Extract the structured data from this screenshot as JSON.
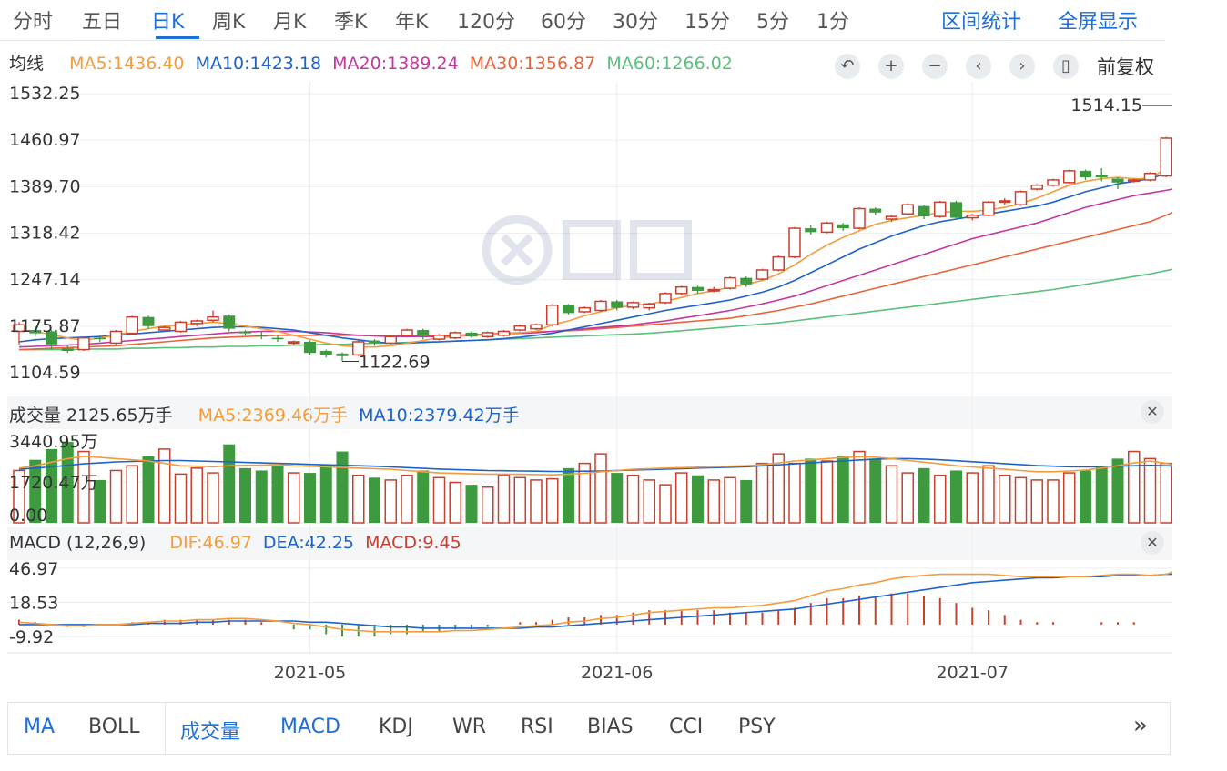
{
  "periods": [
    "分时",
    "五日",
    "日K",
    "周K",
    "月K",
    "季K",
    "年K",
    "120分",
    "60分",
    "30分",
    "15分",
    "5分",
    "1分"
  ],
  "active_period": "日K",
  "right_links": {
    "range_stats": "区间统计",
    "fullscreen": "全屏显示"
  },
  "main": {
    "label": "均线",
    "ma5": "MA5:1436.40",
    "ma10": "MA10:1423.18",
    "ma20": "MA20:1389.24",
    "ma30": "MA30:1356.87",
    "ma60": "MA60:1266.02",
    "adjust": "前复权",
    "y_ticks": [
      "1532.25",
      "1460.97",
      "1389.70",
      "1318.42",
      "1247.14",
      "1175.87",
      "1104.59"
    ],
    "max_label": "1514.15",
    "min_label": "1122.69"
  },
  "volume": {
    "label": "成交量 2125.65万手",
    "ma5": "MA5:2369.46万手",
    "ma10": "MA10:2379.42万手",
    "y_ticks": [
      "3440.95万",
      "1720.47万",
      "0.00"
    ]
  },
  "macd": {
    "label": "MACD (12,26,9)",
    "dif": "DIF:46.97",
    "dea": "DEA:42.25",
    "macd": "MACD:9.45",
    "y_ticks": [
      "46.97",
      "18.53",
      "-9.92"
    ]
  },
  "x_labels": [
    "2021-05",
    "2021-06",
    "2021-07"
  ],
  "indicators": [
    "MA",
    "BOLL",
    "成交量",
    "MACD",
    "KDJ",
    "WR",
    "RSI",
    "BIAS",
    "CCI",
    "PSY"
  ],
  "active_indicators": [
    "MA",
    "成交量",
    "MACD"
  ],
  "colors": {
    "up": "#c8402f",
    "down": "#3d9a3f",
    "ma5": "#f39c3d",
    "ma10": "#1e63c8",
    "ma20": "#c2389e",
    "ma30": "#e8643a",
    "ma60": "#5bc07a",
    "accent": "#1e6fd9"
  },
  "chart_data": [
    {
      "type": "candlestick",
      "title": "",
      "ylim": [
        1104.59,
        1532.25
      ],
      "x_ticks": {
        "2021-05": 18,
        "2021-06": 37,
        "2021-07": 59
      },
      "candles": [
        [
          1168,
          1178,
          1148,
          1182
        ],
        [
          1170,
          1165,
          1160,
          1176
        ],
        [
          1168,
          1148,
          1140,
          1170
        ],
        [
          1142,
          1138,
          1135,
          1146
        ],
        [
          1140,
          1158,
          1138,
          1160
        ],
        [
          1158,
          1156,
          1152,
          1162
        ],
        [
          1150,
          1168,
          1148,
          1170
        ],
        [
          1165,
          1190,
          1163,
          1192
        ],
        [
          1190,
          1176,
          1172,
          1192
        ],
        [
          1170,
          1174,
          1168,
          1176
        ],
        [
          1168,
          1182,
          1166,
          1184
        ],
        [
          1180,
          1184,
          1176,
          1186
        ],
        [
          1185,
          1190,
          1182,
          1200
        ],
        [
          1192,
          1172,
          1168,
          1194
        ],
        [
          1168,
          1165,
          1162,
          1170
        ],
        [
          1162,
          1160,
          1156,
          1168
        ],
        [
          1158,
          1156,
          1152,
          1162
        ],
        [
          1150,
          1152,
          1146,
          1154
        ],
        [
          1152,
          1135,
          1132,
          1154
        ],
        [
          1138,
          1132,
          1128,
          1140
        ],
        [
          1134,
          1130,
          1122,
          1136
        ],
        [
          1132,
          1152,
          1130,
          1154
        ],
        [
          1154,
          1150,
          1146,
          1156
        ],
        [
          1150,
          1160,
          1148,
          1162
        ],
        [
          1162,
          1170,
          1160,
          1172
        ],
        [
          1170,
          1162,
          1156,
          1172
        ],
        [
          1156,
          1162,
          1154,
          1164
        ],
        [
          1158,
          1166,
          1156,
          1168
        ],
        [
          1166,
          1160,
          1158,
          1168
        ],
        [
          1160,
          1166,
          1158,
          1168
        ],
        [
          1162,
          1168,
          1160,
          1170
        ],
        [
          1170,
          1176,
          1168,
          1178
        ],
        [
          1172,
          1178,
          1170,
          1180
        ],
        [
          1178,
          1208,
          1176,
          1210
        ],
        [
          1208,
          1196,
          1194,
          1210
        ],
        [
          1198,
          1204,
          1196,
          1206
        ],
        [
          1200,
          1214,
          1198,
          1216
        ],
        [
          1214,
          1204,
          1200,
          1216
        ],
        [
          1205,
          1212,
          1202,
          1214
        ],
        [
          1204,
          1210,
          1200,
          1212
        ],
        [
          1212,
          1226,
          1210,
          1228
        ],
        [
          1226,
          1236,
          1224,
          1238
        ],
        [
          1236,
          1230,
          1226,
          1238
        ],
        [
          1230,
          1232,
          1228,
          1236
        ],
        [
          1234,
          1250,
          1232,
          1252
        ],
        [
          1250,
          1240,
          1236,
          1252
        ],
        [
          1248,
          1262,
          1246,
          1264
        ],
        [
          1262,
          1282,
          1260,
          1284
        ],
        [
          1282,
          1326,
          1280,
          1328
        ],
        [
          1326,
          1320,
          1316,
          1330
        ],
        [
          1320,
          1334,
          1318,
          1336
        ],
        [
          1332,
          1326,
          1322,
          1334
        ],
        [
          1326,
          1356,
          1324,
          1358
        ],
        [
          1356,
          1350,
          1346,
          1358
        ],
        [
          1340,
          1344,
          1336,
          1346
        ],
        [
          1348,
          1362,
          1346,
          1364
        ],
        [
          1360,
          1344,
          1340,
          1362
        ],
        [
          1344,
          1366,
          1342,
          1368
        ],
        [
          1366,
          1342,
          1340,
          1368
        ],
        [
          1342,
          1346,
          1338,
          1348
        ],
        [
          1346,
          1366,
          1344,
          1368
        ],
        [
          1366,
          1368,
          1362,
          1372
        ],
        [
          1362,
          1382,
          1360,
          1384
        ],
        [
          1386,
          1392,
          1384,
          1394
        ],
        [
          1392,
          1400,
          1390,
          1402
        ],
        [
          1396,
          1414,
          1394,
          1416
        ],
        [
          1414,
          1404,
          1400,
          1416
        ],
        [
          1408,
          1404,
          1398,
          1418
        ],
        [
          1402,
          1396,
          1386,
          1404
        ],
        [
          1398,
          1400,
          1396,
          1402
        ],
        [
          1400,
          1410,
          1398,
          1412
        ],
        [
          1406,
          1464,
          1404,
          1466
        ],
        [
          1478,
          1512,
          1476,
          1514
        ]
      ],
      "ma5": [
        1170,
        1168,
        1163,
        1158,
        1154,
        1158,
        1162,
        1168,
        1172,
        1176,
        1178,
        1180,
        1182,
        1180,
        1176,
        1172,
        1168,
        1162,
        1156,
        1150,
        1146,
        1144,
        1144,
        1146,
        1150,
        1154,
        1158,
        1160,
        1162,
        1163,
        1164,
        1166,
        1168,
        1178,
        1184,
        1192,
        1198,
        1204,
        1208,
        1210,
        1214,
        1220,
        1226,
        1230,
        1236,
        1240,
        1246,
        1256,
        1270,
        1286,
        1300,
        1312,
        1322,
        1332,
        1338,
        1342,
        1346,
        1350,
        1352,
        1352,
        1354,
        1358,
        1364,
        1372,
        1382,
        1392,
        1398,
        1402,
        1404,
        1402,
        1402,
        1418,
        1436
      ],
      "ma10": [
        1152,
        1155,
        1157,
        1158,
        1159,
        1160,
        1162,
        1164,
        1166,
        1168,
        1170,
        1172,
        1174,
        1175,
        1175,
        1174,
        1172,
        1170,
        1166,
        1162,
        1158,
        1155,
        1152,
        1150,
        1150,
        1151,
        1152,
        1153,
        1154,
        1155,
        1157,
        1159,
        1162,
        1165,
        1170,
        1175,
        1180,
        1185,
        1190,
        1195,
        1200,
        1204,
        1208,
        1212,
        1216,
        1222,
        1228,
        1236,
        1246,
        1258,
        1270,
        1282,
        1294,
        1304,
        1314,
        1322,
        1330,
        1336,
        1340,
        1344,
        1348,
        1352,
        1356,
        1360,
        1366,
        1374,
        1382,
        1388,
        1394,
        1398,
        1402,
        1410,
        1423
      ],
      "ma20": [
        1144,
        1145,
        1146,
        1147,
        1148,
        1150,
        1152,
        1154,
        1156,
        1158,
        1160,
        1162,
        1164,
        1166,
        1167,
        1168,
        1168,
        1168,
        1167,
        1166,
        1164,
        1162,
        1161,
        1160,
        1160,
        1160,
        1160,
        1161,
        1162,
        1163,
        1164,
        1165,
        1166,
        1168,
        1170,
        1172,
        1174,
        1176,
        1178,
        1181,
        1184,
        1188,
        1192,
        1196,
        1200,
        1205,
        1210,
        1216,
        1222,
        1230,
        1238,
        1246,
        1254,
        1262,
        1270,
        1278,
        1286,
        1294,
        1302,
        1310,
        1316,
        1322,
        1328,
        1334,
        1342,
        1350,
        1358,
        1364,
        1370,
        1376,
        1380,
        1384,
        1389
      ],
      "ma30": [
        1140,
        1141,
        1142,
        1143,
        1144,
        1145,
        1146,
        1148,
        1150,
        1152,
        1154,
        1156,
        1158,
        1159,
        1160,
        1161,
        1162,
        1162,
        1162,
        1162,
        1162,
        1162,
        1161,
        1161,
        1161,
        1161,
        1162,
        1162,
        1163,
        1164,
        1165,
        1166,
        1167,
        1168,
        1169,
        1170,
        1172,
        1174,
        1176,
        1178,
        1180,
        1182,
        1184,
        1186,
        1188,
        1192,
        1196,
        1200,
        1205,
        1210,
        1216,
        1222,
        1228,
        1234,
        1240,
        1246,
        1252,
        1258,
        1264,
        1270,
        1276,
        1282,
        1288,
        1294,
        1300,
        1306,
        1312,
        1318,
        1324,
        1330,
        1336,
        1346,
        1357
      ],
      "ma60": [
        1140,
        1140,
        1140,
        1140,
        1141,
        1141,
        1141,
        1142,
        1142,
        1143,
        1143,
        1144,
        1144,
        1145,
        1145,
        1146,
        1146,
        1147,
        1147,
        1148,
        1148,
        1149,
        1150,
        1150,
        1151,
        1152,
        1152,
        1153,
        1154,
        1155,
        1156,
        1157,
        1158,
        1159,
        1160,
        1161,
        1162,
        1163,
        1164,
        1165,
        1167,
        1169,
        1171,
        1173,
        1175,
        1177,
        1179,
        1181,
        1184,
        1187,
        1190,
        1193,
        1196,
        1199,
        1202,
        1205,
        1208,
        1211,
        1214,
        1217,
        1220,
        1223,
        1226,
        1229,
        1232,
        1236,
        1240,
        1244,
        1248,
        1252,
        1256,
        1261,
        1266
      ]
    },
    {
      "type": "bar",
      "title": "成交量",
      "ylim": [
        0,
        3440.95
      ],
      "values": [
        2200,
        2650,
        3100,
        3400,
        3000,
        1800,
        2200,
        2400,
        2800,
        3100,
        2050,
        2300,
        2100,
        3300,
        2300,
        2200,
        2400,
        2100,
        2100,
        2450,
        3000,
        2000,
        1900,
        1800,
        2000,
        2200,
        1900,
        1700,
        1600,
        1500,
        2000,
        1900,
        1800,
        1850,
        2300,
        2500,
        2900,
        2100,
        2000,
        1800,
        1600,
        2100,
        2000,
        1800,
        1900,
        1800,
        2500,
        2900,
        2500,
        2700,
        2600,
        2800,
        3000,
        2700,
        2400,
        2100,
        2300,
        2000,
        2200,
        2100,
        2400,
        2000,
        1900,
        1800,
        1800,
        2100,
        2200,
        2400,
        2700,
        3000,
        2700,
        2500,
        2125.65
      ],
      "ma5": [
        2300,
        2400,
        2550,
        2700,
        2800,
        2750,
        2700,
        2650,
        2600,
        2500,
        2400,
        2380,
        2350,
        2400,
        2420,
        2420,
        2450,
        2400,
        2380,
        2350,
        2330,
        2300,
        2280,
        2250,
        2200,
        2150,
        2100,
        2080,
        2060,
        2050,
        2050,
        2040,
        2030,
        2020,
        2040,
        2080,
        2150,
        2200,
        2250,
        2280,
        2300,
        2320,
        2340,
        2360,
        2380,
        2400,
        2450,
        2520,
        2600,
        2650,
        2700,
        2750,
        2780,
        2760,
        2700,
        2620,
        2550,
        2480,
        2400,
        2350,
        2300,
        2250,
        2200,
        2150,
        2150,
        2180,
        2220,
        2300,
        2400,
        2520,
        2600,
        2500,
        2369.46
      ],
      "ma10": [
        2250,
        2300,
        2350,
        2420,
        2480,
        2520,
        2560,
        2580,
        2600,
        2620,
        2620,
        2600,
        2580,
        2560,
        2540,
        2520,
        2500,
        2480,
        2460,
        2440,
        2420,
        2400,
        2380,
        2350,
        2320,
        2290,
        2260,
        2240,
        2220,
        2200,
        2190,
        2180,
        2170,
        2160,
        2160,
        2170,
        2180,
        2200,
        2220,
        2240,
        2260,
        2280,
        2300,
        2320,
        2340,
        2360,
        2400,
        2440,
        2480,
        2520,
        2560,
        2600,
        2640,
        2680,
        2700,
        2700,
        2680,
        2650,
        2610,
        2570,
        2530,
        2490,
        2450,
        2410,
        2380,
        2360,
        2350,
        2360,
        2380,
        2400,
        2420,
        2400,
        2379.42
      ]
    },
    {
      "type": "bar",
      "title": "MACD (12,26,9)",
      "ylim": [
        -9.92,
        46.97
      ],
      "dif": [
        2,
        1,
        0,
        -1,
        -1,
        0,
        0,
        1,
        2,
        3,
        3,
        4,
        4,
        5,
        5,
        4,
        3,
        1,
        0,
        -2,
        -4,
        -5,
        -6,
        -6,
        -6,
        -6,
        -6,
        -5,
        -5,
        -4,
        -3,
        -2,
        -1,
        0,
        2,
        3,
        5,
        6,
        8,
        10,
        11,
        12,
        13,
        14,
        14,
        15,
        16,
        18,
        20,
        24,
        28,
        30,
        33,
        35,
        38,
        40,
        41,
        42,
        42,
        42,
        42,
        41,
        40,
        40,
        40,
        40,
        40,
        41,
        42,
        42,
        41,
        42,
        47
      ],
      "dea": [
        0,
        0,
        0,
        0,
        0,
        0,
        0,
        0,
        1,
        1,
        1,
        2,
        2,
        3,
        3,
        3,
        3,
        3,
        2,
        2,
        1,
        0,
        -1,
        -2,
        -2,
        -3,
        -3,
        -3,
        -3,
        -3,
        -3,
        -3,
        -2,
        -2,
        -1,
        0,
        1,
        2,
        3,
        4,
        5,
        6,
        7,
        8,
        9,
        10,
        11,
        12,
        13,
        15,
        17,
        19,
        21,
        23,
        25,
        27,
        29,
        31,
        33,
        35,
        36,
        37,
        38,
        39,
        39,
        40,
        40,
        40,
        41,
        41,
        41,
        42,
        42.25
      ],
      "macd": [
        4,
        2,
        0,
        -2,
        -2,
        0,
        0,
        2,
        2,
        4,
        4,
        4,
        4,
        4,
        4,
        2,
        0,
        -4,
        -4,
        -8,
        -10,
        -10,
        -10,
        -8,
        -8,
        -6,
        -6,
        -4,
        -4,
        -2,
        0,
        2,
        2,
        4,
        6,
        6,
        8,
        8,
        10,
        12,
        12,
        12,
        12,
        12,
        10,
        10,
        10,
        12,
        14,
        18,
        22,
        22,
        24,
        24,
        26,
        26,
        24,
        22,
        18,
        14,
        12,
        8,
        4,
        2,
        2,
        0,
        0,
        2,
        2,
        2,
        0,
        0,
        9.45
      ]
    }
  ]
}
